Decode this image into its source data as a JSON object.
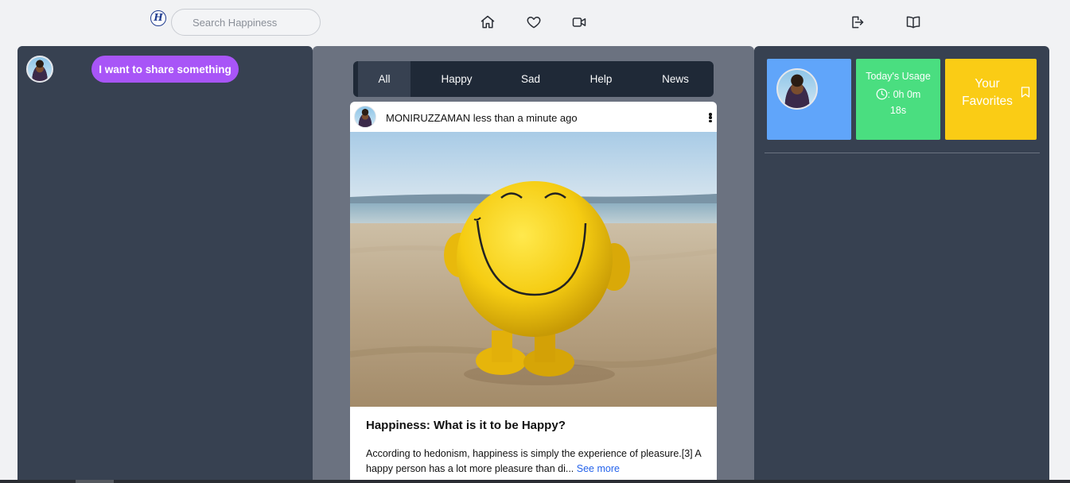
{
  "header": {
    "logo_letter": "H",
    "search_placeholder": "Search Happiness",
    "nav_icons": [
      "home-icon",
      "heart-icon",
      "video-icon"
    ],
    "right_icons": [
      "logout-icon",
      "book-icon"
    ]
  },
  "left": {
    "share_label": "I want to share something"
  },
  "tabs": {
    "items": [
      "All",
      "Happy",
      "Sad",
      "Help",
      "News"
    ],
    "active": "All"
  },
  "post": {
    "author": "MONIRUZZAMAN",
    "time": "less than a minute ago",
    "title": "Happiness: What is it to be Happy?",
    "body": "According to hedonism, happiness is simply the experience of pleasure.[3] A happy person has a lot more pleasure than di...",
    "see_more": "See more"
  },
  "widgets": {
    "usage_title": "Today's Usage",
    "usage_time_a": ": 0h 0m",
    "usage_time_b": "18s",
    "favorites_label": "Your Favorites"
  },
  "colors": {
    "side_panel": "#374151",
    "mid_panel": "#6b7280",
    "tabs_bg": "#1f2937",
    "share_button": "#a855f7",
    "profile_tile": "#60a5fa",
    "usage_tile": "#4ade80",
    "favorites_tile": "#facc15",
    "link": "#2563eb"
  }
}
